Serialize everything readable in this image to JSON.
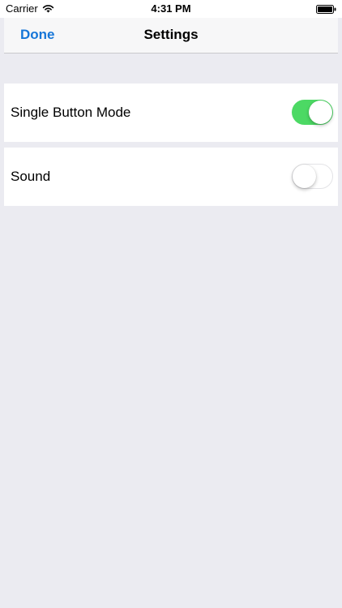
{
  "status_bar": {
    "carrier": "Carrier",
    "time": "4:31 PM"
  },
  "nav": {
    "done_label": "Done",
    "title": "Settings",
    "accent_color": "#1676d8"
  },
  "settings": [
    {
      "label": "Single Button Mode",
      "enabled": true
    },
    {
      "label": "Sound",
      "enabled": false
    }
  ],
  "colors": {
    "switch_on": "#4cd964",
    "background": "#ebebf1"
  },
  "icons": [
    "wifi-icon",
    "battery-icon"
  ]
}
